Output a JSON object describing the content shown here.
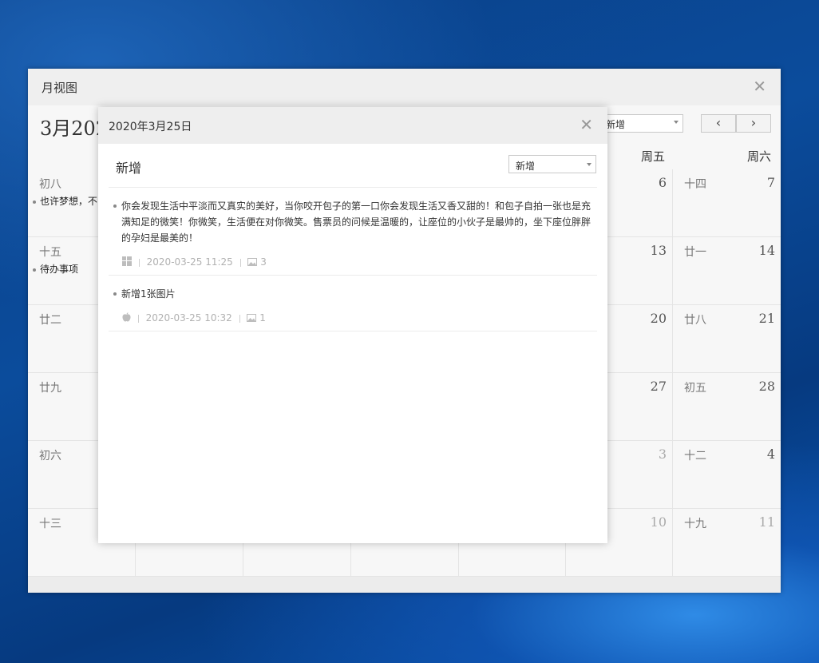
{
  "window": {
    "title": "月视图",
    "close_glyph": "✕",
    "month_label": "3月202",
    "filter_select": {
      "value": "新增"
    },
    "prev_glyph": "‹",
    "next_glyph": "›"
  },
  "weekdays": [
    "周五",
    "周六"
  ],
  "calendar": {
    "rows": [
      {
        "left_lunar": "初八",
        "left_event": "也许梦想，不",
        "fri_day": "6",
        "sat_lunar": "十四",
        "sat_day": "7",
        "dim": false
      },
      {
        "left_lunar": "十五",
        "left_event": "待办事项",
        "fri_day": "13",
        "sat_lunar": "廿一",
        "sat_day": "14",
        "dim": false
      },
      {
        "left_lunar": "廿二",
        "left_event": "",
        "fri_day": "20",
        "sat_lunar": "廿八",
        "sat_day": "21",
        "dim": false
      },
      {
        "left_lunar": "廿九",
        "left_event": "",
        "fri_day": "27",
        "sat_lunar": "初五",
        "sat_day": "28",
        "dim": false
      },
      {
        "left_lunar": "初六",
        "left_event": "",
        "fri_day": "3",
        "sat_lunar": "十二",
        "sat_day": "4",
        "dim": true
      },
      {
        "left_lunar": "十三",
        "left_event": "",
        "fri_day": "10",
        "sat_lunar": "十九",
        "sat_day": "11",
        "dim": true
      }
    ]
  },
  "dialog": {
    "title": "2020年3月25日",
    "close_glyph": "✕",
    "section_title": "新增",
    "select_value": "新增",
    "notes": [
      {
        "text": "你会发现生活中平淡而又真实的美好，当你咬开包子的第一口你会发现生活又香又甜的！和包子自拍一张也是充满知足的微笑！你微笑，生活便在对你微笑。售票员的问候是温暖的，让座位的小伙子是最帅的，坐下座位胖胖的孕妇是最美的！",
        "device_icon": "windows-icon",
        "time": "2020-03-25 11:25",
        "image_count": "3"
      },
      {
        "text": "新增1张图片",
        "device_icon": "apple-icon",
        "time": "2020-03-25 10:32",
        "image_count": "1"
      }
    ]
  },
  "colors": {
    "accent_gray": "#eeeeee",
    "desktop_blue": "#0b4c9c"
  }
}
